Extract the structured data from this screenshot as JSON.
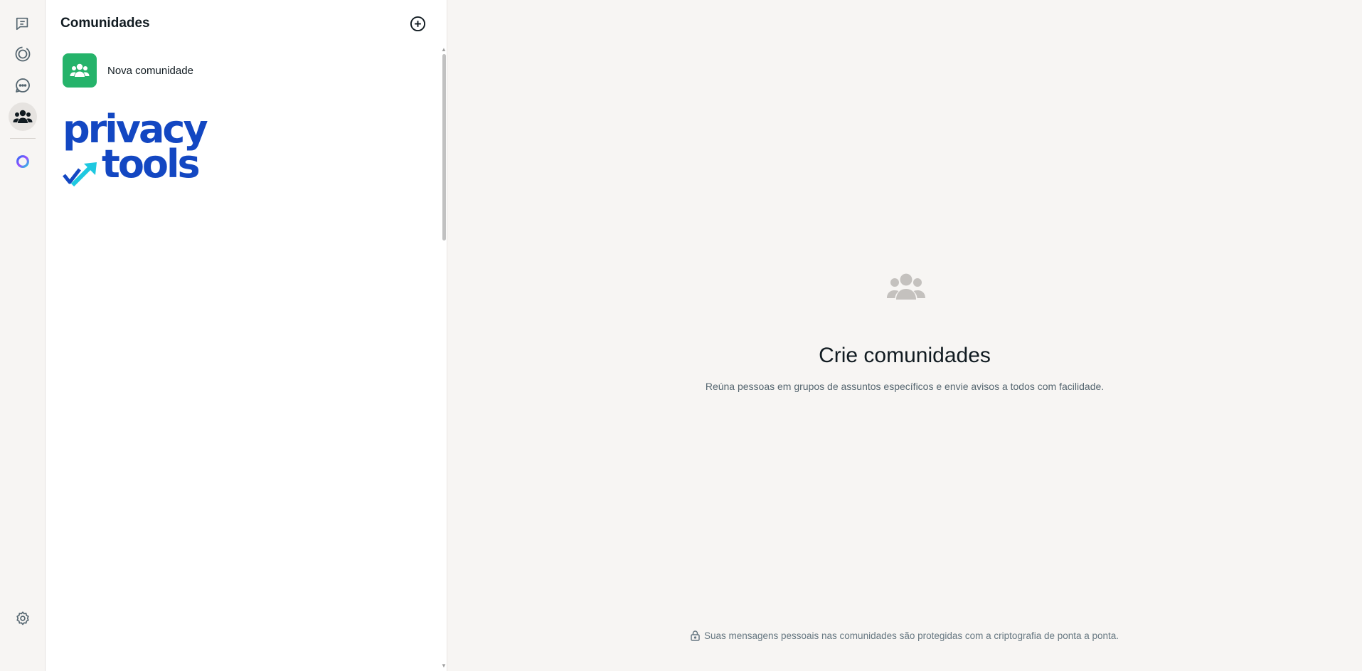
{
  "rail": {
    "items": [
      {
        "name": "chats"
      },
      {
        "name": "status"
      },
      {
        "name": "channels"
      },
      {
        "name": "communities"
      },
      {
        "name": "meta-ai"
      }
    ],
    "settings": "settings"
  },
  "panel": {
    "title": "Comunidades",
    "new_community_label": "Nova comunidade",
    "logo": {
      "line1": "privacy",
      "line2": "tools"
    }
  },
  "main": {
    "title": "Crie comunidades",
    "subtitle": "Reúna pessoas em grupos de assuntos específicos e envie avisos a todos com facilidade.",
    "footer": "Suas mensagens pessoais nas comunidades são protegidas com a criptografia de ponta a ponta."
  },
  "colors": {
    "accent_green": "#25b36a",
    "logo_blue": "#1347c2",
    "logo_cyan": "#1ec8e0",
    "background": "#f7f5f3"
  }
}
